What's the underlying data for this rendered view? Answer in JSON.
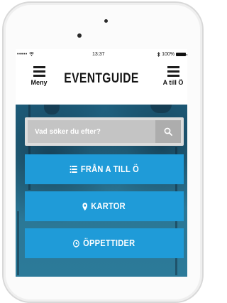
{
  "status_bar": {
    "signal": "•••••",
    "time": "13:37",
    "battery": "100%"
  },
  "header": {
    "menu_label": "Meny",
    "logo": "EVENTGUIDE",
    "atillo_label": "A till Ö"
  },
  "search": {
    "placeholder": "Vad söker du efter?"
  },
  "actions": [
    {
      "label": "FRÅN A TILL Ö",
      "icon": "list-icon"
    },
    {
      "label": "KARTOR",
      "icon": "map-marker-icon"
    },
    {
      "label": "ÖPPETTIDER",
      "icon": "clock-icon"
    }
  ],
  "colors": {
    "accent": "#1f9bd8",
    "hero": "#2a7594"
  }
}
